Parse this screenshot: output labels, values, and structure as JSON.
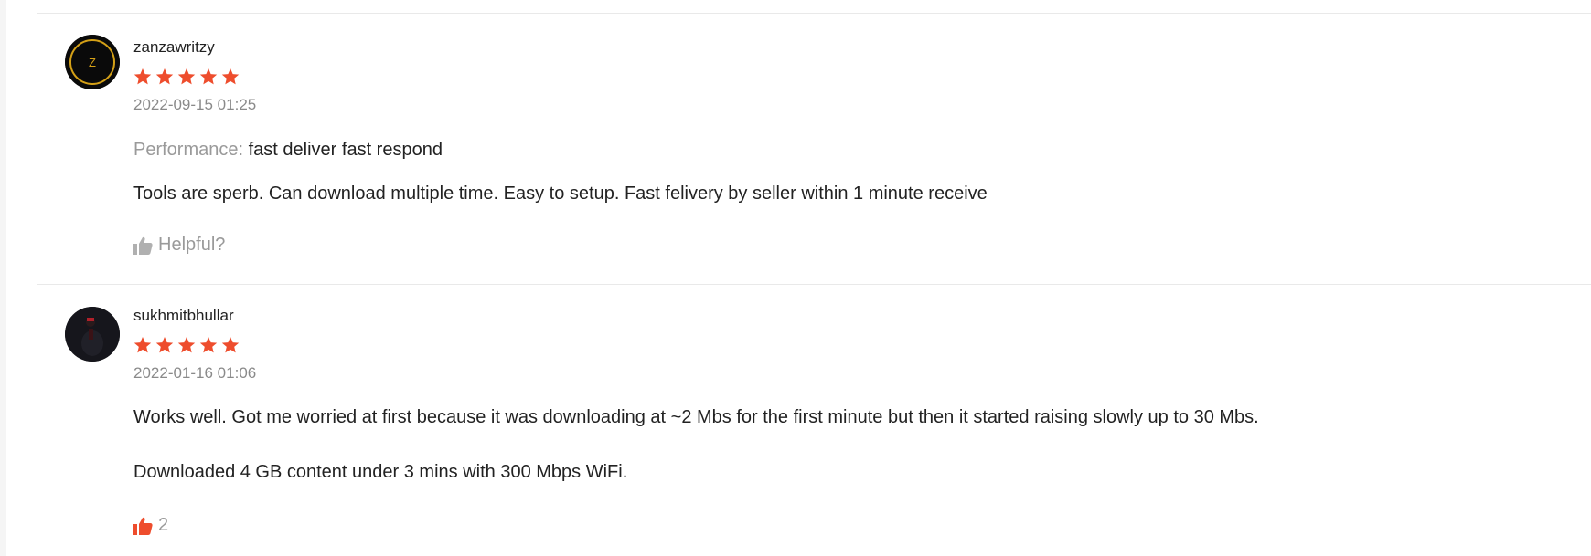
{
  "colors": {
    "star": "#ee4d2d",
    "thumb_active": "#ee4d2d",
    "thumb_inactive": "#b0b0b0",
    "avatar_ring": "#d4a017"
  },
  "reviews": [
    {
      "username": "zanzawritzy",
      "avatar_initial": "Z",
      "rating": 5,
      "date": "2022-09-15 01:25",
      "performance_label": "Performance:",
      "performance_value": "fast deliver fast respond",
      "paragraphs": [
        "Tools are sperb. Can download multiple time. Easy to setup. Fast felivery by seller within 1 minute receive"
      ],
      "helpful_text": "Helpful?",
      "helpful_icon": "thumbs-up-icon"
    },
    {
      "username": "sukhmitbhullar",
      "rating": 5,
      "date": "2022-01-16 01:06",
      "paragraphs": [
        "Works well. Got me worried at first because it was downloading at ~2 Mbs for the first minute but then it started raising slowly up to 30 Mbs.",
        "Downloaded 4 GB content under 3 mins with 300 Mbps WiFi."
      ],
      "helpful_text": "2",
      "helpful_icon": "thumbs-up-icon"
    }
  ]
}
